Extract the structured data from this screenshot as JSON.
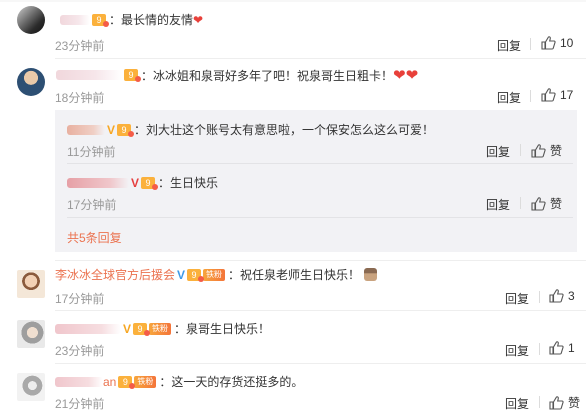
{
  "comments": [
    {
      "text": "：最长情的友情",
      "emoji": "❤",
      "time": "23分钟前",
      "reply_label": "回复",
      "like_count": "10"
    },
    {
      "text": "：冰冰姐和泉哥好多年了吧！祝泉哥生日粗卡！",
      "emoji": "❤❤",
      "time": "18分钟前",
      "reply_label": "回复",
      "like_count": "17",
      "replies": [
        {
          "text": "：刘大壮这个账号太有意思啦，一个保安怎么这么可爱！",
          "time": "11分钟前",
          "reply_label": "回复",
          "like_label": "赞"
        },
        {
          "text": "：生日快乐",
          "time": "17分钟前",
          "reply_label": "回复",
          "like_label": "赞"
        }
      ],
      "more_label": "共5条回复"
    },
    {
      "name": "李冰冰全球官方后援会",
      "badge": "铁粉",
      "text": "：祝任泉老师生日快乐！",
      "time": "17分钟前",
      "reply_label": "回复",
      "like_count": "3"
    },
    {
      "badge": "铁粉",
      "text": "：泉哥生日快乐！",
      "time": "23分钟前",
      "reply_label": "回复",
      "like_count": "1"
    },
    {
      "name_suffix": "an",
      "badge": "铁粉",
      "text": "：这一天的存货还挺多的。",
      "time": "21分钟前",
      "reply_label": "回复",
      "like_label": "赞"
    }
  ],
  "icons": {
    "like": "thumbs-up-icon",
    "level": "level-badge-icon",
    "verified": "verified-v-icon",
    "emoji_cake": "cake-emoji-icon"
  },
  "colors": {
    "name": "#eb7350",
    "time": "#999999",
    "reply_bg": "#f2f2f5",
    "heart": "#e8403a"
  }
}
